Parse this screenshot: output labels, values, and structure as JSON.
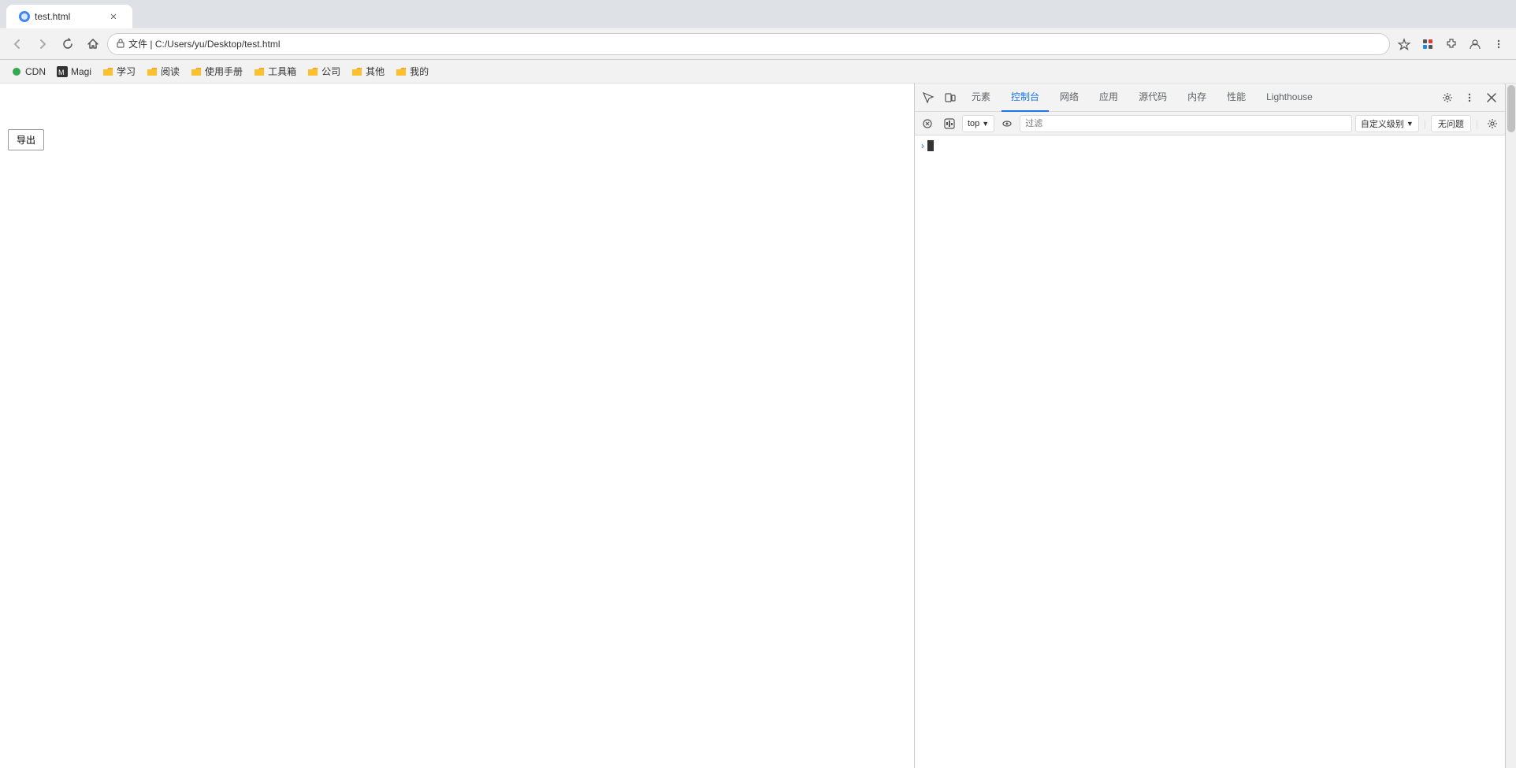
{
  "browser": {
    "tab": {
      "title": "test.html",
      "favicon_color": "#4285f4"
    },
    "address_bar": {
      "protocol": "文件",
      "url": "C:/Users/yu/Desktop/test.html"
    },
    "nav_buttons": {
      "back": "←",
      "forward": "→",
      "refresh": "↺",
      "home": "⌂"
    }
  },
  "bookmarks": [
    {
      "id": "cdn",
      "label": "CDN",
      "type": "dot"
    },
    {
      "id": "magi",
      "label": "Magi",
      "type": "icon"
    },
    {
      "id": "study",
      "label": "学习",
      "type": "folder"
    },
    {
      "id": "read",
      "label": "阅读",
      "type": "folder"
    },
    {
      "id": "manual",
      "label": "使用手册",
      "type": "folder"
    },
    {
      "id": "tools",
      "label": "工具箱",
      "type": "folder"
    },
    {
      "id": "company",
      "label": "公司",
      "type": "folder"
    },
    {
      "id": "others",
      "label": "其他",
      "type": "folder"
    },
    {
      "id": "mine",
      "label": "我的",
      "type": "folder"
    }
  ],
  "page": {
    "export_button_label": "导出"
  },
  "devtools": {
    "tabs": [
      {
        "id": "elements",
        "label": "元素",
        "active": false
      },
      {
        "id": "console",
        "label": "控制台",
        "active": true
      },
      {
        "id": "network",
        "label": "网络",
        "active": false
      },
      {
        "id": "application",
        "label": "应用",
        "active": false
      },
      {
        "id": "sources",
        "label": "源代码",
        "active": false
      },
      {
        "id": "memory",
        "label": "内存",
        "active": false
      },
      {
        "id": "performance",
        "label": "性能",
        "active": false
      },
      {
        "id": "lighthouse",
        "label": "Lighthouse",
        "active": false
      }
    ],
    "toolbar": {
      "context_selector": "top",
      "filter_placeholder": "过滤",
      "severity_label": "自定义级别",
      "no_issues_label": "无问题"
    },
    "console": {
      "prompt_chevron": "›"
    }
  }
}
